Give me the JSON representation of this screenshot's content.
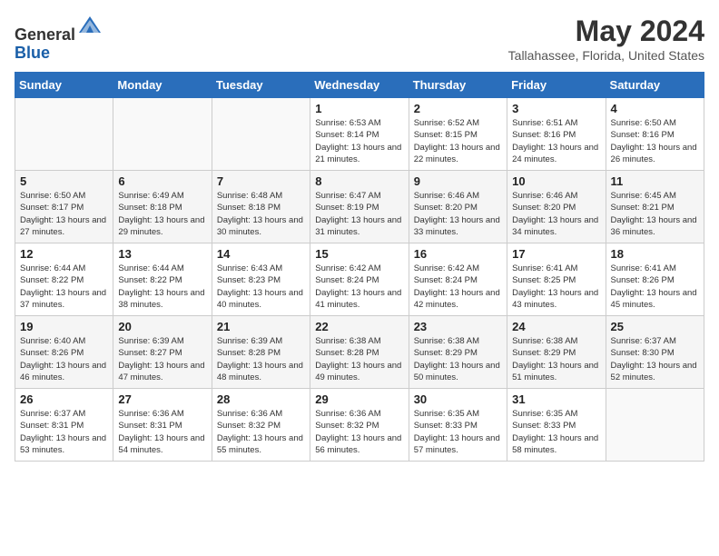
{
  "header": {
    "logo_general": "General",
    "logo_blue": "Blue",
    "month_title": "May 2024",
    "subtitle": "Tallahassee, Florida, United States"
  },
  "days_of_week": [
    "Sunday",
    "Monday",
    "Tuesday",
    "Wednesday",
    "Thursday",
    "Friday",
    "Saturday"
  ],
  "weeks": [
    [
      {
        "day": "",
        "sunrise": "",
        "sunset": "",
        "daylight": ""
      },
      {
        "day": "",
        "sunrise": "",
        "sunset": "",
        "daylight": ""
      },
      {
        "day": "",
        "sunrise": "",
        "sunset": "",
        "daylight": ""
      },
      {
        "day": "1",
        "sunrise": "Sunrise: 6:53 AM",
        "sunset": "Sunset: 8:14 PM",
        "daylight": "Daylight: 13 hours and 21 minutes."
      },
      {
        "day": "2",
        "sunrise": "Sunrise: 6:52 AM",
        "sunset": "Sunset: 8:15 PM",
        "daylight": "Daylight: 13 hours and 22 minutes."
      },
      {
        "day": "3",
        "sunrise": "Sunrise: 6:51 AM",
        "sunset": "Sunset: 8:16 PM",
        "daylight": "Daylight: 13 hours and 24 minutes."
      },
      {
        "day": "4",
        "sunrise": "Sunrise: 6:50 AM",
        "sunset": "Sunset: 8:16 PM",
        "daylight": "Daylight: 13 hours and 26 minutes."
      }
    ],
    [
      {
        "day": "5",
        "sunrise": "Sunrise: 6:50 AM",
        "sunset": "Sunset: 8:17 PM",
        "daylight": "Daylight: 13 hours and 27 minutes."
      },
      {
        "day": "6",
        "sunrise": "Sunrise: 6:49 AM",
        "sunset": "Sunset: 8:18 PM",
        "daylight": "Daylight: 13 hours and 29 minutes."
      },
      {
        "day": "7",
        "sunrise": "Sunrise: 6:48 AM",
        "sunset": "Sunset: 8:18 PM",
        "daylight": "Daylight: 13 hours and 30 minutes."
      },
      {
        "day": "8",
        "sunrise": "Sunrise: 6:47 AM",
        "sunset": "Sunset: 8:19 PM",
        "daylight": "Daylight: 13 hours and 31 minutes."
      },
      {
        "day": "9",
        "sunrise": "Sunrise: 6:46 AM",
        "sunset": "Sunset: 8:20 PM",
        "daylight": "Daylight: 13 hours and 33 minutes."
      },
      {
        "day": "10",
        "sunrise": "Sunrise: 6:46 AM",
        "sunset": "Sunset: 8:20 PM",
        "daylight": "Daylight: 13 hours and 34 minutes."
      },
      {
        "day": "11",
        "sunrise": "Sunrise: 6:45 AM",
        "sunset": "Sunset: 8:21 PM",
        "daylight": "Daylight: 13 hours and 36 minutes."
      }
    ],
    [
      {
        "day": "12",
        "sunrise": "Sunrise: 6:44 AM",
        "sunset": "Sunset: 8:22 PM",
        "daylight": "Daylight: 13 hours and 37 minutes."
      },
      {
        "day": "13",
        "sunrise": "Sunrise: 6:44 AM",
        "sunset": "Sunset: 8:22 PM",
        "daylight": "Daylight: 13 hours and 38 minutes."
      },
      {
        "day": "14",
        "sunrise": "Sunrise: 6:43 AM",
        "sunset": "Sunset: 8:23 PM",
        "daylight": "Daylight: 13 hours and 40 minutes."
      },
      {
        "day": "15",
        "sunrise": "Sunrise: 6:42 AM",
        "sunset": "Sunset: 8:24 PM",
        "daylight": "Daylight: 13 hours and 41 minutes."
      },
      {
        "day": "16",
        "sunrise": "Sunrise: 6:42 AM",
        "sunset": "Sunset: 8:24 PM",
        "daylight": "Daylight: 13 hours and 42 minutes."
      },
      {
        "day": "17",
        "sunrise": "Sunrise: 6:41 AM",
        "sunset": "Sunset: 8:25 PM",
        "daylight": "Daylight: 13 hours and 43 minutes."
      },
      {
        "day": "18",
        "sunrise": "Sunrise: 6:41 AM",
        "sunset": "Sunset: 8:26 PM",
        "daylight": "Daylight: 13 hours and 45 minutes."
      }
    ],
    [
      {
        "day": "19",
        "sunrise": "Sunrise: 6:40 AM",
        "sunset": "Sunset: 8:26 PM",
        "daylight": "Daylight: 13 hours and 46 minutes."
      },
      {
        "day": "20",
        "sunrise": "Sunrise: 6:39 AM",
        "sunset": "Sunset: 8:27 PM",
        "daylight": "Daylight: 13 hours and 47 minutes."
      },
      {
        "day": "21",
        "sunrise": "Sunrise: 6:39 AM",
        "sunset": "Sunset: 8:28 PM",
        "daylight": "Daylight: 13 hours and 48 minutes."
      },
      {
        "day": "22",
        "sunrise": "Sunrise: 6:38 AM",
        "sunset": "Sunset: 8:28 PM",
        "daylight": "Daylight: 13 hours and 49 minutes."
      },
      {
        "day": "23",
        "sunrise": "Sunrise: 6:38 AM",
        "sunset": "Sunset: 8:29 PM",
        "daylight": "Daylight: 13 hours and 50 minutes."
      },
      {
        "day": "24",
        "sunrise": "Sunrise: 6:38 AM",
        "sunset": "Sunset: 8:29 PM",
        "daylight": "Daylight: 13 hours and 51 minutes."
      },
      {
        "day": "25",
        "sunrise": "Sunrise: 6:37 AM",
        "sunset": "Sunset: 8:30 PM",
        "daylight": "Daylight: 13 hours and 52 minutes."
      }
    ],
    [
      {
        "day": "26",
        "sunrise": "Sunrise: 6:37 AM",
        "sunset": "Sunset: 8:31 PM",
        "daylight": "Daylight: 13 hours and 53 minutes."
      },
      {
        "day": "27",
        "sunrise": "Sunrise: 6:36 AM",
        "sunset": "Sunset: 8:31 PM",
        "daylight": "Daylight: 13 hours and 54 minutes."
      },
      {
        "day": "28",
        "sunrise": "Sunrise: 6:36 AM",
        "sunset": "Sunset: 8:32 PM",
        "daylight": "Daylight: 13 hours and 55 minutes."
      },
      {
        "day": "29",
        "sunrise": "Sunrise: 6:36 AM",
        "sunset": "Sunset: 8:32 PM",
        "daylight": "Daylight: 13 hours and 56 minutes."
      },
      {
        "day": "30",
        "sunrise": "Sunrise: 6:35 AM",
        "sunset": "Sunset: 8:33 PM",
        "daylight": "Daylight: 13 hours and 57 minutes."
      },
      {
        "day": "31",
        "sunrise": "Sunrise: 6:35 AM",
        "sunset": "Sunset: 8:33 PM",
        "daylight": "Daylight: 13 hours and 58 minutes."
      },
      {
        "day": "",
        "sunrise": "",
        "sunset": "",
        "daylight": ""
      }
    ]
  ]
}
